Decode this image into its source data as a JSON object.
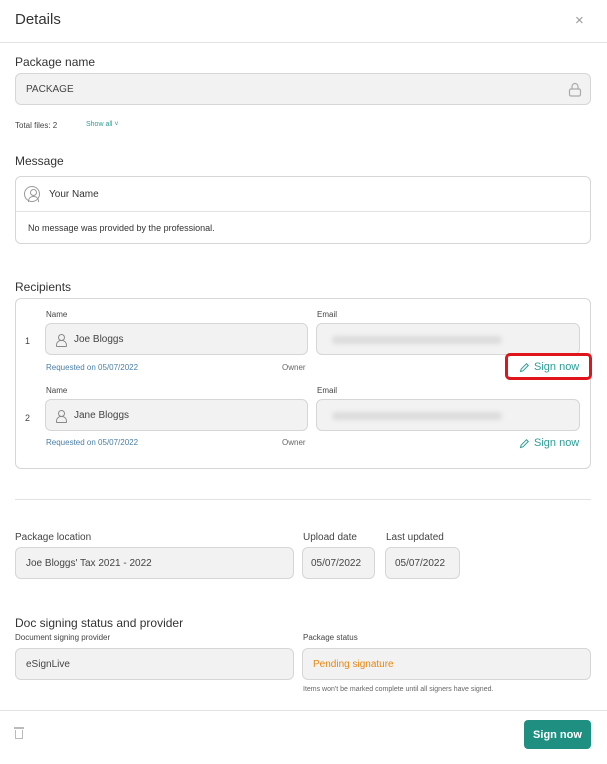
{
  "header": {
    "title": "Details",
    "close": "×"
  },
  "package": {
    "label": "Package name",
    "value": "PACKAGE",
    "total_files": "Total files: 2",
    "show_all": "Show all ˅"
  },
  "message": {
    "label": "Message",
    "sender": "Your Name",
    "text": "No message was provided by the professional."
  },
  "recipients": {
    "label": "Recipients",
    "name_label": "Name",
    "email_label": "Email",
    "owner_label": "Owner",
    "sign_now": "Sign now",
    "items": [
      {
        "index": "1",
        "name": "Joe Bloggs",
        "requested": "Requested on 05/07/2022"
      },
      {
        "index": "2",
        "name": "Jane Bloggs",
        "requested": "Requested on 05/07/2022"
      }
    ]
  },
  "location": {
    "label": "Package location",
    "value": "Joe Bloggs' Tax 2021 - 2022",
    "upload_label": "Upload date",
    "upload_value": "05/07/2022",
    "updated_label": "Last updated",
    "updated_value": "05/07/2022"
  },
  "signing": {
    "label": "Doc signing status and provider",
    "provider_label": "Document signing provider",
    "provider_value": "eSignLive",
    "status_label": "Package status",
    "status_value": "Pending signature",
    "note": "Items won't be marked complete until all signers have signed."
  },
  "footer": {
    "sign_now": "Sign now"
  },
  "colors": {
    "accent": "#2a9d96",
    "primary": "#1f8f82",
    "pending": "#e8870f",
    "highlight": "#e0151b"
  }
}
